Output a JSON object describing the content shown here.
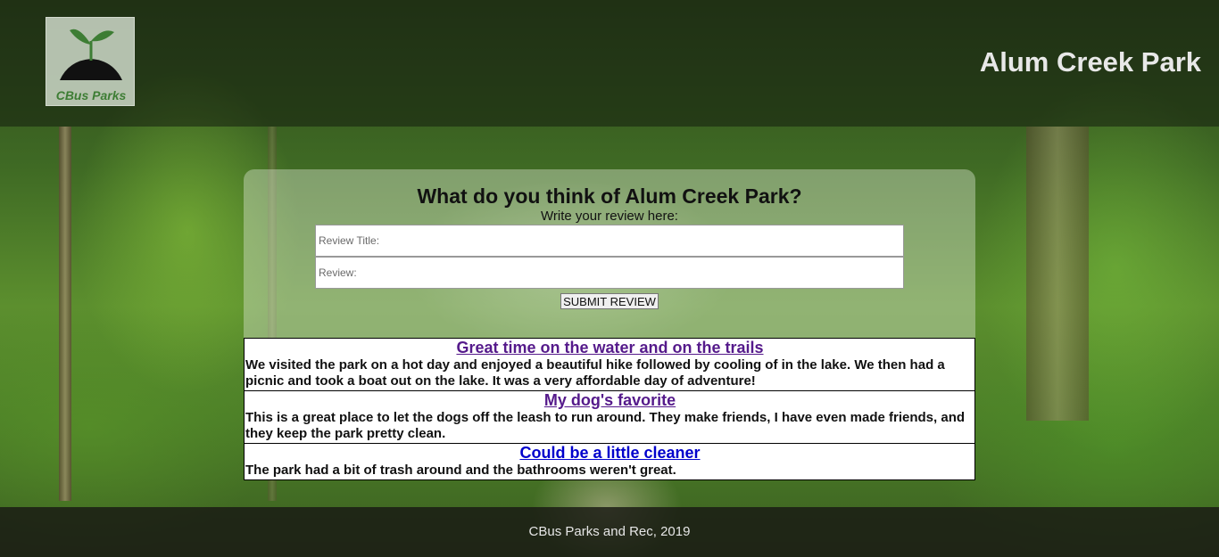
{
  "header": {
    "logo_text": "CBus Parks",
    "site_title": "Alum Creek Park"
  },
  "review_form": {
    "heading": "What do you think of Alum Creek Park?",
    "subheading": "Write your review here:",
    "title_placeholder": "Review Title:",
    "review_placeholder": "Review:",
    "submit_label": "SUBMIT REVIEW"
  },
  "reviews": [
    {
      "title": "Great time on the water and on the trails",
      "body": "We visited the park on a hot day and enjoyed a beautiful hike followed by cooling of in the lake. We then had a picnic and took a boat out on the lake. It was a very affordable day of adventure!"
    },
    {
      "title": "My dog's favorite",
      "body": "This is a great place to let the dogs off the leash to run around. They make friends, I have even made friends, and they keep the park pretty clean."
    },
    {
      "title": "Could be a little cleaner",
      "body": "The park had a bit of trash around and the bathrooms weren't great."
    }
  ],
  "footer": {
    "text": "CBus Parks and Rec, 2019"
  },
  "colors": {
    "visited_link": "#551a8b",
    "link": "#0000cc",
    "logo_green": "#3d7d34",
    "title_text": "#e8e8e8"
  }
}
